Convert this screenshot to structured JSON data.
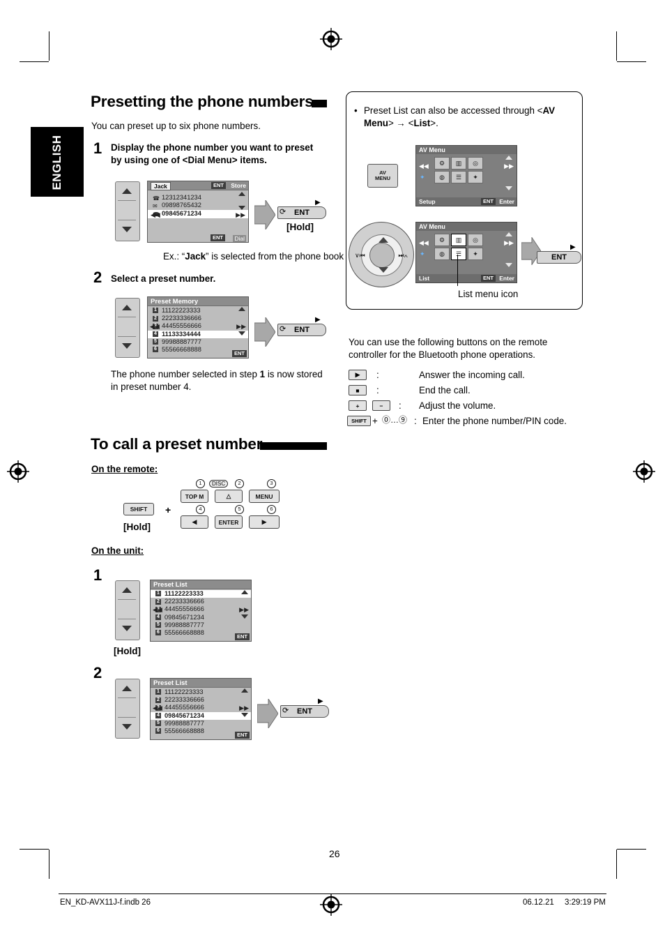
{
  "page": {
    "language_tab": "ENGLISH",
    "page_number": "26",
    "footer_left": "EN_KD-AVX11J-f.indb   26",
    "footer_right_date": "06.12.21",
    "footer_right_time": "3:29:19 PM"
  },
  "section1": {
    "title": "Presetting the phone numbers",
    "intro": "You can preset up to six phone numbers.",
    "step1": {
      "number": "1",
      "text": "Display the phone number you want to preset by using one of <Dial Menu> items.",
      "lcd": {
        "header": "Jack",
        "header_right_ent": "ENT",
        "header_right_label": "Store",
        "rows": [
          {
            "icon": "☎",
            "text": "12312341234"
          },
          {
            "icon": "✉",
            "text": "09898765432"
          },
          {
            "icon": "☎",
            "text": "09845671234",
            "highlight": true
          }
        ],
        "footer_ent": "ENT",
        "footer_label": "Dial"
      },
      "ent_button": "ENT",
      "hold_label": "[Hold]",
      "example": "Ex.: “Jack” is selected from the phone book"
    },
    "step2": {
      "number": "2",
      "text": "Select a preset number.",
      "lcd": {
        "header": "Preset Memory",
        "rows": [
          {
            "num": "1",
            "text": "11122223333"
          },
          {
            "num": "2",
            "text": "22233336666"
          },
          {
            "num": "3",
            "text": "44455556666"
          },
          {
            "num": "4",
            "text": "11133334444",
            "highlight": true
          },
          {
            "num": "5",
            "text": "99988887777"
          },
          {
            "num": "6",
            "text": "55566668888"
          }
        ],
        "footer_ent": "ENT"
      },
      "ent_button": "ENT",
      "result": "The phone number selected in step 1 is now stored in preset number 4."
    }
  },
  "section2": {
    "title": "To call a preset number",
    "on_remote_label": "On the remote:",
    "remote": {
      "shift_key": "SHIFT",
      "plus": "+",
      "hold_label": "[Hold]",
      "keys": [
        {
          "index": "1",
          "label": "TOP M"
        },
        {
          "index": "2",
          "label": "DISC△"
        },
        {
          "index": "3",
          "label": "MENU"
        },
        {
          "index": "4",
          "label": "◀"
        },
        {
          "index": "5",
          "label": "ENTER"
        },
        {
          "index": "6",
          "label": "▶"
        }
      ],
      "key2_glyph": "△"
    },
    "on_unit_label": "On the unit:",
    "unit_step1": {
      "number": "1",
      "lcd": {
        "header": "Preset List",
        "rows": [
          {
            "num": "1",
            "text": "11122223333",
            "highlight": true
          },
          {
            "num": "2",
            "text": "22233336666"
          },
          {
            "num": "3",
            "text": "44455556666"
          },
          {
            "num": "4",
            "text": "09845671234"
          },
          {
            "num": "5",
            "text": "99988887777"
          },
          {
            "num": "6",
            "text": "55566668888"
          }
        ],
        "footer_ent": "ENT"
      },
      "hold_label": "[Hold]"
    },
    "unit_step2": {
      "number": "2",
      "lcd": {
        "header": "Preset List",
        "rows": [
          {
            "num": "1",
            "text": "11122223333"
          },
          {
            "num": "2",
            "text": "22233336666"
          },
          {
            "num": "3",
            "text": "44455556666"
          },
          {
            "num": "4",
            "text": "09845671234",
            "highlight": true
          },
          {
            "num": "5",
            "text": "99988887777"
          },
          {
            "num": "6",
            "text": "55566668888"
          }
        ],
        "footer_ent": "ENT"
      },
      "ent_button": "ENT"
    }
  },
  "right_column": {
    "note_bullet": "•",
    "note_parts": {
      "p1": "Preset List can also be accessed through <",
      "b1": "AV Menu",
      "p2": "> → <",
      "b2": "List",
      "p3": ">."
    },
    "av_menu_1": {
      "title": "AV Menu",
      "footer_label": "Setup",
      "footer_ent": "ENT",
      "footer_enter": "Enter"
    },
    "av_menu_2": {
      "title": "AV Menu",
      "footer_label": "List",
      "footer_ent": "ENT",
      "footer_enter": "Enter"
    },
    "av_menu_button": {
      "line1": "AV",
      "line2": "MENU"
    },
    "list_menu_icon_caption": "List menu icon",
    "ent_button": "ENT",
    "remote_intro": "You can use the following buttons on the remote controller for the Bluetooth phone operations.",
    "operations": [
      {
        "key": "▶",
        "sep": ":",
        "desc": "Answer the incoming call."
      },
      {
        "key": "■",
        "sep": ":",
        "desc": "End the call."
      },
      {
        "key": "+",
        "key2": "−",
        "sep": ":",
        "desc": "Adjust the volume."
      },
      {
        "key": "SHIFT",
        "key2": "⓪…⑨",
        "sep": ":",
        "desc": "Enter the phone number/PIN code."
      }
    ],
    "op3_plus": "+",
    "op4_plus": "+"
  }
}
